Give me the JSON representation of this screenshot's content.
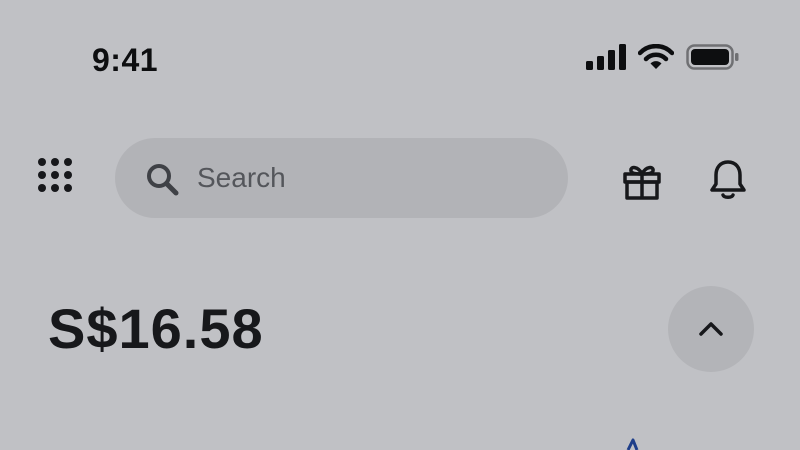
{
  "status_bar": {
    "time": "9:41"
  },
  "header": {
    "search": {
      "placeholder": "Search"
    },
    "icons": [
      "grid-menu-icon",
      "search-icon",
      "gift-icon",
      "bell-icon"
    ]
  },
  "account": {
    "balance": "S$16.58",
    "toggle_icon": "chevron-up-icon"
  },
  "colors": {
    "background": "#c0c1c5",
    "search_background": "#b2b3b7",
    "text_primary": "#141518",
    "text_placeholder": "#54565b",
    "chart_accent": "#1f3f8a"
  }
}
